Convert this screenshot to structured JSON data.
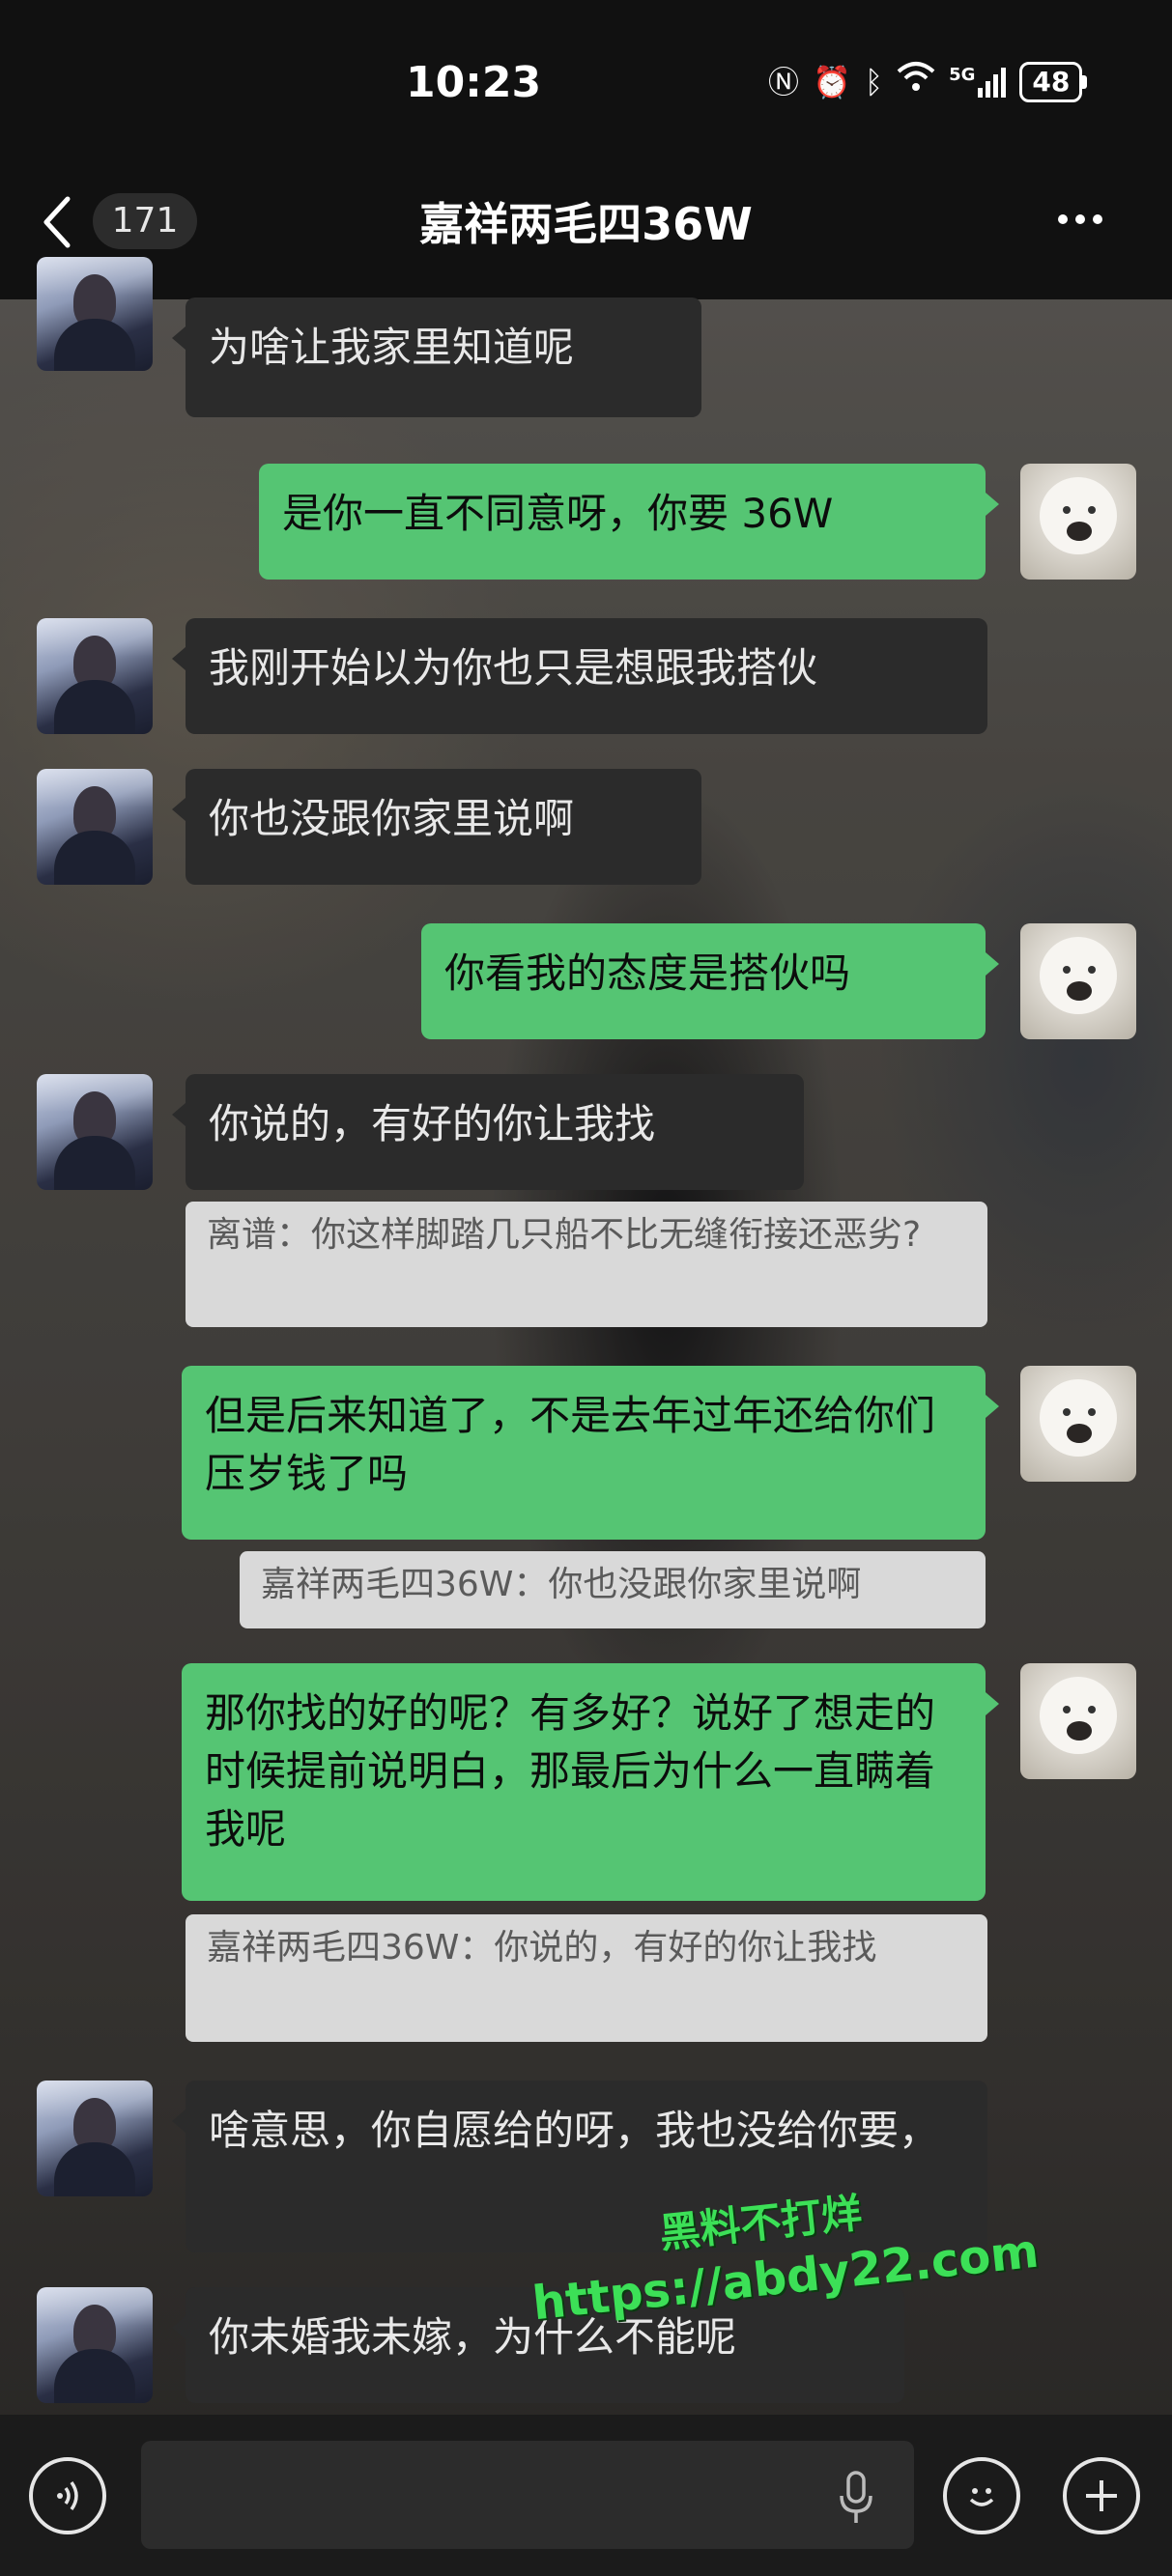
{
  "status_bar": {
    "time": "10:23",
    "icons": [
      "nfc-icon",
      "alarm-icon",
      "bluetooth-icon",
      "wifi-icon",
      "signal-5g-icon"
    ],
    "network": "5G",
    "battery": "48"
  },
  "header": {
    "unread_count": "171",
    "title": "嘉祥两毛四36W"
  },
  "messages": [
    {
      "side": "in",
      "text": "为啥让我家里知道呢"
    },
    {
      "side": "out",
      "text": "是你一直不同意呀，你要 36W"
    },
    {
      "side": "in",
      "text": "我刚开始以为你也只是想跟我搭伙"
    },
    {
      "side": "in",
      "text": "你也没跟你家里说啊"
    },
    {
      "side": "out",
      "text": "你看我的态度是搭伙吗"
    },
    {
      "side": "in",
      "text": "你说的，有好的你让我找"
    },
    {
      "side": "quote",
      "text": "离谱：你这样脚踏几只船不比无缝衔接还恶劣?"
    },
    {
      "side": "out",
      "text": "但是后来知道了，不是去年过年还给你们压岁钱了吗"
    },
    {
      "side": "quote",
      "text": "嘉祥两毛四36W：你也没跟你家里说啊"
    },
    {
      "side": "out",
      "text": "那你找的好的呢？有多好？说好了想走的时候提前说明白，那最后为什么一直瞒着我呢"
    },
    {
      "side": "quote",
      "text": "嘉祥两毛四36W：你说的，有好的你让我找"
    },
    {
      "side": "in",
      "text": "啥意思，你自愿给的呀，我也没给你要，"
    },
    {
      "side": "in",
      "text": "你未婚我未嫁，为什么不能呢"
    }
  ],
  "watermark": {
    "line1": "黑料不打烊",
    "line2": "https://abdy22.com"
  },
  "colors": {
    "outgoing_bubble": "#55c573",
    "incoming_bubble": "#2b2b2b",
    "watermark": "#3ce057"
  }
}
